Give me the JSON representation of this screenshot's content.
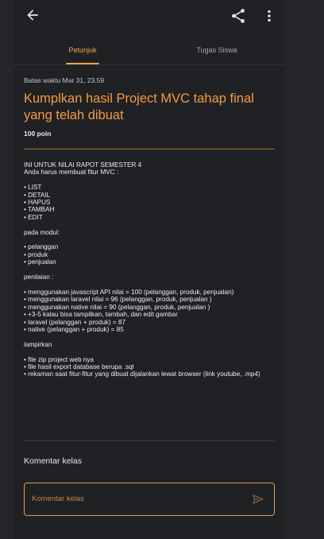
{
  "tabs": [
    {
      "label": "Petunjuk",
      "active": true
    },
    {
      "label": "Tugas Siswa",
      "active": false
    }
  ],
  "assignment": {
    "deadline": "Batas waktu Mar 31, 23.59",
    "title": "Kumplkan hasil Project MVC tahap final yang telah dibuat",
    "points": "100 poin",
    "body": "INI UNTUK NILAI RAPOT SEMESTER 4\nAnda harus membuat fitur MVC :\n\n• LIST\n• DETAIL\n• HAPUS\n• TAMBAH\n• EDIT\n\npada modul:\n\n• pelanggan\n• produk\n• penjualan\n\npenilaian :\n\n• menggunakan javascript API nilai = 100 (pelanggan, produk, penjualan)\n• menggunakan laravel nilai = 96 (pelanggan, produk, penjualan  )\n• menggunakan native nilai = 90 (pelanggan, produk, penjualan  )\n• +3-5  kalau bisa tampilkan, tambah, dan edit gambar\n• laravel (pelanggan + produk) = 87\n• native (pelanggan + produk) = 85\n\nlampirkan\n\n• file zip project web nya\n• file hasil export database berupa .sql\n• rekaman saat fitur-fitur yang dibuat dijalankan lewat browser (link youtube, .mp4)"
  },
  "comments": {
    "title": "Komentar kelas",
    "placeholder": "Komentar kelas"
  },
  "icons": {
    "back": "arrow-back-icon",
    "share": "share-icon",
    "more": "more-vert-icon",
    "send": "send-icon"
  },
  "colors": {
    "accent": "#f0a34a",
    "background": "#202124"
  }
}
